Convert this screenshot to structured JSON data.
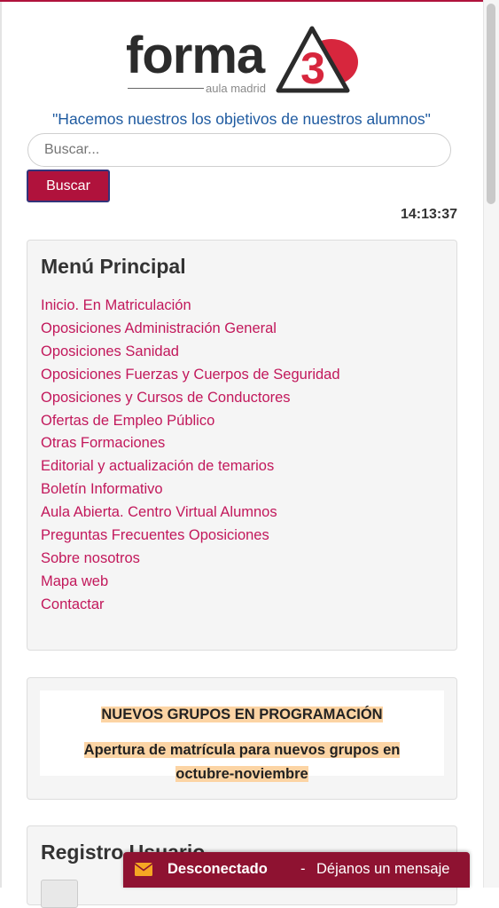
{
  "brand": {
    "logo_word": "forma",
    "logo_number": "3",
    "logo_sub": "aula madrid",
    "slogan": "\"Hacemos nuestros los objetivos de nuestros alumnos\"",
    "colors": {
      "brand_red": "#b0123c",
      "link": "#c2185b",
      "slogan": "#1e5aa0",
      "highlight": "#fcd4a4",
      "chat_bar": "#8e1231"
    }
  },
  "search": {
    "placeholder": "Buscar...",
    "value": "",
    "button_label": "Buscar"
  },
  "clock": "14:13:37",
  "main_menu": {
    "title": "Menú Principal",
    "items": [
      "Inicio. En Matriculación",
      "Oposiciones Administración General",
      "Oposiciones Sanidad",
      "Oposiciones Fuerzas y Cuerpos de Seguridad",
      "Oposiciones y Cursos de Conductores",
      "Ofertas de Empleo Público",
      "Otras Formaciones",
      "Editorial y actualización de temarios",
      "Boletín Informativo",
      "Aula Abierta. Centro Virtual Alumnos",
      "Preguntas Frecuentes Oposiciones",
      "Sobre nosotros",
      "Mapa web",
      "Contactar"
    ]
  },
  "promo": {
    "title": "NUEVOS GRUPOS EN PROGRAMACIÓN",
    "line1": "Apertura de matrícula para nuevos grupos en",
    "line2": "octubre-noviembre"
  },
  "registration": {
    "title": "Registro Usuario"
  },
  "chat": {
    "icon": "envelope-icon",
    "status": "Desconectado",
    "separator": "-",
    "message": "Déjanos un mensaje"
  }
}
